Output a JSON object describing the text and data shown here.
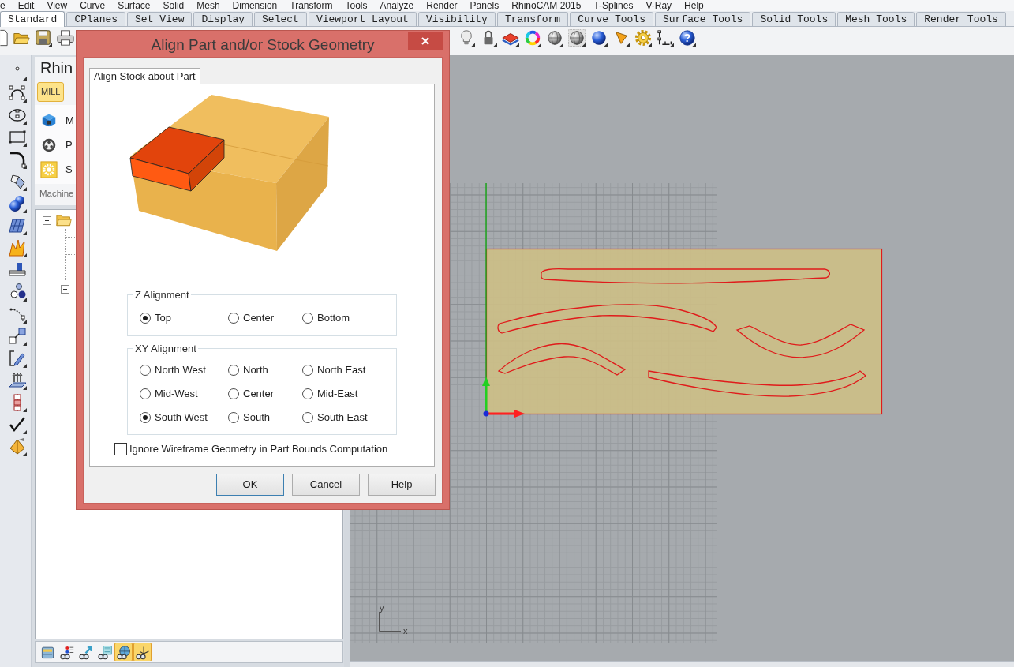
{
  "menu_bar": [
    "e",
    "Edit",
    "View",
    "Curve",
    "Surface",
    "Solid",
    "Mesh",
    "Dimension",
    "Transform",
    "Tools",
    "Analyze",
    "Render",
    "Panels",
    "RhinoCAM 2015",
    "T-Splines",
    "V-Ray",
    "Help"
  ],
  "toolbar_tabs": [
    {
      "label": "Standard",
      "selected": true
    },
    {
      "label": "CPlanes",
      "selected": false
    },
    {
      "label": "Set View",
      "selected": false
    },
    {
      "label": "Display",
      "selected": false
    },
    {
      "label": "Select",
      "selected": false
    },
    {
      "label": "Viewport Layout",
      "selected": false
    },
    {
      "label": "Visibility",
      "selected": false
    },
    {
      "label": "Transform",
      "selected": false
    },
    {
      "label": "Curve Tools",
      "selected": false
    },
    {
      "label": "Surface Tools",
      "selected": false
    },
    {
      "label": "Solid Tools",
      "selected": false
    },
    {
      "label": "Mesh Tools",
      "selected": false
    },
    {
      "label": "Render Tools",
      "selected": false
    }
  ],
  "toolbar": {
    "help_icon_text": "?"
  },
  "side_panel": {
    "title": "Rhin",
    "mill_tab": {
      "label": "MILL",
      "selected": true
    },
    "items": [
      "M",
      "P",
      "S"
    ],
    "section_label": "Machine",
    "tree": [
      {
        "expanded": true,
        "children": [
          {
            "expanded": true
          }
        ]
      }
    ],
    "bottom_toolbar": [
      {
        "selected": false
      },
      {
        "selected": false
      },
      {
        "selected": false
      },
      {
        "selected": false
      },
      {
        "selected": true
      },
      {
        "selected": true
      }
    ]
  },
  "viewport": {
    "axis_indicator": {
      "y_label": "y",
      "x_label": "x"
    }
  },
  "dialog": {
    "title": "Align Part and/or Stock Geometry",
    "tabs": [
      {
        "label": "Align Stock about Part",
        "selected": true
      }
    ],
    "z_alignment": {
      "label": "Z Alignment",
      "options": [
        {
          "label": "Top",
          "selected": true
        },
        {
          "label": "Center",
          "selected": false
        },
        {
          "label": "Bottom",
          "selected": false
        }
      ]
    },
    "xy_alignment": {
      "label": "XY Alignment",
      "options": [
        {
          "label": "North West",
          "selected": false
        },
        {
          "label": "North",
          "selected": false
        },
        {
          "label": "North East",
          "selected": false
        },
        {
          "label": "Mid-West",
          "selected": false
        },
        {
          "label": "Center",
          "selected": false
        },
        {
          "label": "Mid-East",
          "selected": false
        },
        {
          "label": "South West",
          "selected": true
        },
        {
          "label": "South",
          "selected": false
        },
        {
          "label": "South East",
          "selected": false
        }
      ]
    },
    "ignore_wireframe": {
      "label": "Ignore Wireframe Geometry in Part Bounds Computation",
      "checked": false
    },
    "buttons": [
      {
        "label": "OK",
        "default": true
      },
      {
        "label": "Cancel",
        "default": false
      },
      {
        "label": "Help",
        "default": false
      }
    ]
  }
}
